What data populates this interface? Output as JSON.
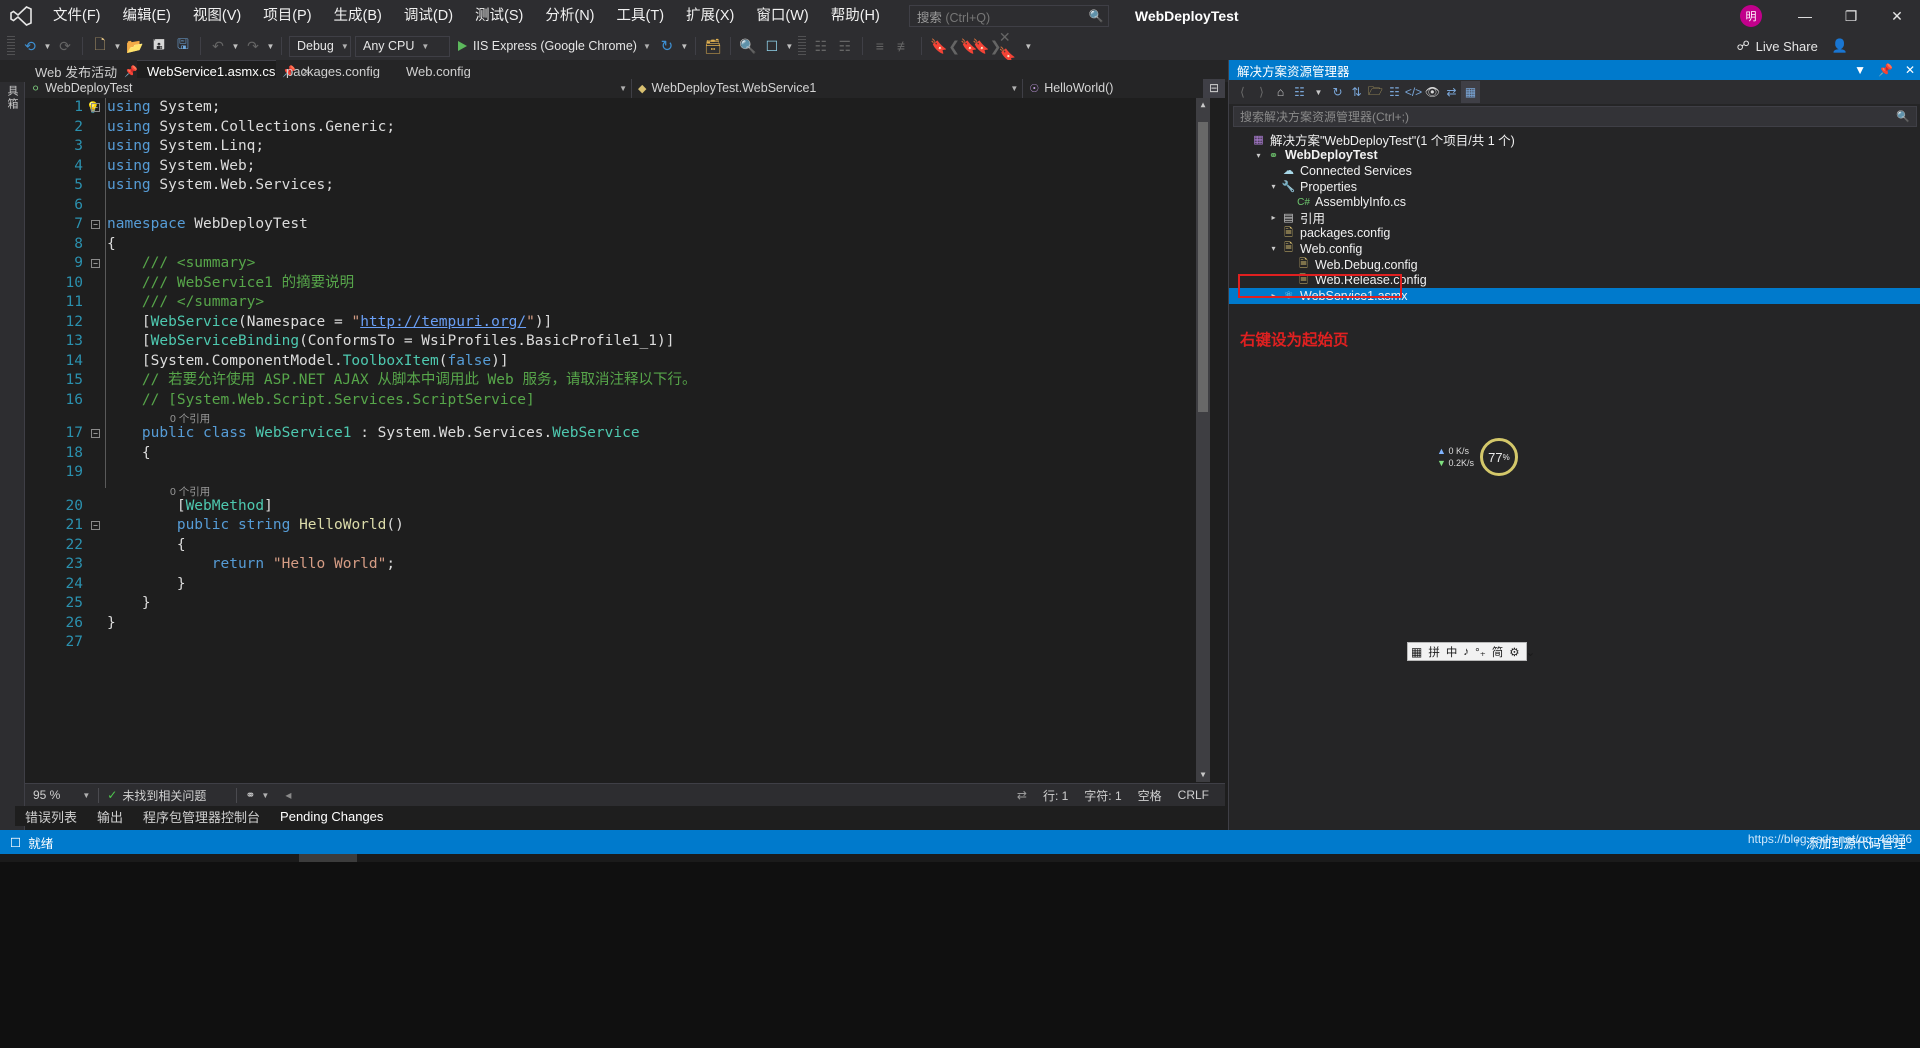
{
  "app": {
    "project_title": "WebDeployTest",
    "logo_icon": "visual-studio-logo-icon"
  },
  "menu": {
    "items": [
      {
        "label": "文件(F)"
      },
      {
        "label": "编辑(E)"
      },
      {
        "label": "视图(V)"
      },
      {
        "label": "项目(P)"
      },
      {
        "label": "生成(B)"
      },
      {
        "label": "调试(D)"
      },
      {
        "label": "测试(S)"
      },
      {
        "label": "分析(N)"
      },
      {
        "label": "工具(T)"
      },
      {
        "label": "扩展(X)"
      },
      {
        "label": "窗口(W)"
      },
      {
        "label": "帮助(H)"
      }
    ]
  },
  "search": {
    "label": "搜索",
    "placeholder": "(Ctrl+Q)",
    "icon": "search-icon"
  },
  "window_controls": {
    "avatar_text": "明",
    "minimize": "—",
    "restore": "❐",
    "close": "✕"
  },
  "toolbar": {
    "navigate_back_icon": "navigate-back-icon",
    "navigate_forward_icon": "navigate-forward-icon",
    "new_item_icon": "new-item-icon",
    "open_file_icon": "open-file-icon",
    "save_icon": "save-icon",
    "save_all_icon": "save-all-icon",
    "undo_icon": "undo-icon",
    "redo_icon": "redo-icon",
    "configuration": "Debug",
    "platform": "Any CPU",
    "run_target": "IIS Express (Google Chrome)",
    "refresh_icon": "refresh-icon",
    "play_icon": "play-icon",
    "live_share_label": "Live Share",
    "live_share_icon": "live-share-icon",
    "share_person_icon": "share-person-icon",
    "extra_icons": [
      "attach-to-process-icon",
      "find-in-files-icon",
      "browser-preview-icon",
      "decrease-indent-icon",
      "comment-icon",
      "uncomment-icon",
      "increase-indent-icon",
      "decrease-line-indent-icon",
      "bookmark-icon",
      "previous-bookmark-icon",
      "next-bookmark-icon",
      "clear-bookmark-icon"
    ]
  },
  "left_rail": {
    "label": "工具箱"
  },
  "tabs": [
    {
      "label": "Web 发布活动",
      "active": false,
      "pinned": true,
      "closable": false
    },
    {
      "label": "WebService1.asmx.cs",
      "active": true,
      "pinned": true,
      "closable": true
    },
    {
      "label": "packages.config",
      "active": false,
      "pinned": false,
      "closable": false
    },
    {
      "label": "Web.config",
      "active": false,
      "pinned": false,
      "closable": false
    }
  ],
  "tabstrip_controls": {
    "dropdown_icon": "chevron-down-icon",
    "settings_icon": "gear-icon"
  },
  "navbar": {
    "project": "WebDeployTest",
    "type": "WebDeployTest.WebService1",
    "member": "HelloWorld()",
    "project_icon": "web-project-icon",
    "type_icon": "class-icon",
    "member_icon": "method-icon",
    "split_icon": "split-editor-icon"
  },
  "code": {
    "lines": [
      {
        "n": 1,
        "ref": null,
        "fold": "minus",
        "bulb": true,
        "tokens": [
          {
            "t": "using",
            "c": "kw"
          },
          {
            "t": " System;",
            "c": "pln"
          }
        ]
      },
      {
        "n": 2,
        "ref": null,
        "fold": null,
        "bulb": false,
        "tokens": [
          {
            "t": "using",
            "c": "kw"
          },
          {
            "t": " System.Collections.Generic;",
            "c": "pln"
          }
        ]
      },
      {
        "n": 3,
        "ref": null,
        "fold": null,
        "bulb": false,
        "tokens": [
          {
            "t": "using",
            "c": "kw"
          },
          {
            "t": " System.Linq;",
            "c": "pln"
          }
        ]
      },
      {
        "n": 4,
        "ref": null,
        "fold": null,
        "bulb": false,
        "tokens": [
          {
            "t": "using",
            "c": "kw"
          },
          {
            "t": " System.Web;",
            "c": "pln"
          }
        ]
      },
      {
        "n": 5,
        "ref": null,
        "fold": null,
        "bulb": false,
        "tokens": [
          {
            "t": "using",
            "c": "kw"
          },
          {
            "t": " System.Web.Services;",
            "c": "pln"
          }
        ]
      },
      {
        "n": 6,
        "ref": null,
        "fold": null,
        "bulb": false,
        "tokens": []
      },
      {
        "n": 7,
        "ref": null,
        "fold": "minus",
        "bulb": false,
        "tokens": [
          {
            "t": "namespace",
            "c": "kw"
          },
          {
            "t": " WebDeployTest",
            "c": "pln"
          }
        ]
      },
      {
        "n": 8,
        "ref": null,
        "fold": null,
        "bulb": false,
        "tokens": [
          {
            "t": "{",
            "c": "pln"
          }
        ]
      },
      {
        "n": 9,
        "ref": null,
        "fold": "minus",
        "bulb": false,
        "tokens": [
          {
            "t": "    /// <summary>",
            "c": "cmt"
          }
        ]
      },
      {
        "n": 10,
        "ref": null,
        "fold": null,
        "bulb": false,
        "tokens": [
          {
            "t": "    /// WebService1 的摘要说明",
            "c": "cmt"
          }
        ]
      },
      {
        "n": 11,
        "ref": null,
        "fold": null,
        "bulb": false,
        "tokens": [
          {
            "t": "    /// </summary>",
            "c": "cmt"
          }
        ]
      },
      {
        "n": 12,
        "ref": null,
        "fold": null,
        "bulb": false,
        "tokens": [
          {
            "t": "    [",
            "c": "pln"
          },
          {
            "t": "WebService",
            "c": "typ"
          },
          {
            "t": "(Namespace = ",
            "c": "pln"
          },
          {
            "t": "\"",
            "c": "str"
          },
          {
            "t": "http://tempuri.org/",
            "c": "lnk"
          },
          {
            "t": "\"",
            "c": "str"
          },
          {
            "t": ")]",
            "c": "pln"
          }
        ]
      },
      {
        "n": 13,
        "ref": null,
        "fold": null,
        "bulb": false,
        "tokens": [
          {
            "t": "    [",
            "c": "pln"
          },
          {
            "t": "WebServiceBinding",
            "c": "typ"
          },
          {
            "t": "(ConformsTo = WsiProfiles.BasicProfile1_1)]",
            "c": "pln"
          }
        ]
      },
      {
        "n": 14,
        "ref": null,
        "fold": null,
        "bulb": false,
        "tokens": [
          {
            "t": "    [System.ComponentModel.",
            "c": "pln"
          },
          {
            "t": "ToolboxItem",
            "c": "typ"
          },
          {
            "t": "(",
            "c": "pln"
          },
          {
            "t": "false",
            "c": "kw"
          },
          {
            "t": ")]",
            "c": "pln"
          }
        ]
      },
      {
        "n": 15,
        "ref": null,
        "fold": null,
        "bulb": false,
        "tokens": [
          {
            "t": "    // 若要允许使用 ASP.NET AJAX 从脚本中调用此 Web 服务，请取消注释以下行。",
            "c": "cmt"
          }
        ]
      },
      {
        "n": 16,
        "ref": null,
        "fold": null,
        "bulb": false,
        "tokens": [
          {
            "t": "    // [System.Web.Script.Services.ScriptService]",
            "c": "cmt"
          }
        ]
      },
      {
        "n": 17,
        "ref": "0 个引用",
        "fold": "minus",
        "bulb": false,
        "tokens": [
          {
            "t": "    public",
            "c": "kw"
          },
          {
            "t": " ",
            "c": "pln"
          },
          {
            "t": "class",
            "c": "kw"
          },
          {
            "t": " ",
            "c": "pln"
          },
          {
            "t": "WebService1",
            "c": "typ"
          },
          {
            "t": " : System.Web.Services.",
            "c": "pln"
          },
          {
            "t": "WebService",
            "c": "typ"
          }
        ]
      },
      {
        "n": 18,
        "ref": null,
        "fold": null,
        "bulb": false,
        "tokens": [
          {
            "t": "    {",
            "c": "pln"
          }
        ]
      },
      {
        "n": 19,
        "ref": null,
        "fold": null,
        "bulb": false,
        "tokens": []
      },
      {
        "n": 20,
        "ref": "0 个引用",
        "fold": null,
        "bulb": false,
        "tokens": [
          {
            "t": "        [",
            "c": "pln"
          },
          {
            "t": "WebMethod",
            "c": "typ"
          },
          {
            "t": "]",
            "c": "pln"
          }
        ]
      },
      {
        "n": 21,
        "ref": null,
        "fold": "minus",
        "bulb": false,
        "tokens": [
          {
            "t": "        public",
            "c": "kw"
          },
          {
            "t": " ",
            "c": "pln"
          },
          {
            "t": "string",
            "c": "kw"
          },
          {
            "t": " ",
            "c": "pln"
          },
          {
            "t": "HelloWorld",
            "c": "fn"
          },
          {
            "t": "()",
            "c": "pln"
          }
        ]
      },
      {
        "n": 22,
        "ref": null,
        "fold": null,
        "bulb": false,
        "tokens": [
          {
            "t": "        {",
            "c": "pln"
          }
        ]
      },
      {
        "n": 23,
        "ref": null,
        "fold": null,
        "bulb": false,
        "tokens": [
          {
            "t": "            return",
            "c": "kw"
          },
          {
            "t": " ",
            "c": "pln"
          },
          {
            "t": "\"Hello World\"",
            "c": "str"
          },
          {
            "t": ";",
            "c": "pln"
          }
        ]
      },
      {
        "n": 24,
        "ref": null,
        "fold": null,
        "bulb": false,
        "tokens": [
          {
            "t": "        }",
            "c": "pln"
          }
        ]
      },
      {
        "n": 25,
        "ref": null,
        "fold": null,
        "bulb": false,
        "tokens": [
          {
            "t": "    }",
            "c": "pln"
          }
        ]
      },
      {
        "n": 26,
        "ref": null,
        "fold": null,
        "bulb": false,
        "tokens": [
          {
            "t": "}",
            "c": "pln"
          }
        ]
      },
      {
        "n": 27,
        "ref": null,
        "fold": null,
        "bulb": false,
        "tokens": []
      }
    ]
  },
  "editor_status": {
    "zoom": "95 %",
    "issues": "未找到相关问题",
    "issue_icon": "check-circle-icon",
    "line_label": "行: 1",
    "col_label": "字符: 1",
    "spaces": "空格",
    "eol": "CRLF",
    "nav_icon": "navigation-icon"
  },
  "bottom_tabs": [
    {
      "label": "错误列表"
    },
    {
      "label": "输出"
    },
    {
      "label": "程序包管理器控制台"
    },
    {
      "label": "Pending Changes",
      "selected": true
    }
  ],
  "status_bar": {
    "ready": "就绪",
    "ready_icon": "ready-icon",
    "right_text": "添加到源代码管理",
    "right_icon": "source-control-icon"
  },
  "solution_explorer": {
    "title": "解决方案资源管理器",
    "title_controls": {
      "dropdown_icon": "chevron-down-icon",
      "pin_icon": "pin-icon",
      "close_icon": "close-icon"
    },
    "toolbar_icons": [
      "back-icon",
      "forward-icon",
      "home-icon",
      "pending-changes-icon",
      "chevron-down-icon",
      "refresh-icon",
      "collapse-all-icon",
      "show-all-files-icon",
      "properties-window-icon",
      "view-code-icon",
      "preview-selected-icon",
      "sync-with-active-icon",
      "solution-explorer-icon"
    ],
    "search_placeholder": "搜索解决方案资源管理器(Ctrl+;)",
    "search_icon": "search-icon",
    "tree": [
      {
        "indent": 0,
        "twisty": "",
        "icon": "solution-icon",
        "label": "解决方案\"WebDeployTest\"(1 个项目/共 1 个)",
        "bold": false,
        "selected": false
      },
      {
        "indent": 1,
        "twisty": "expanded",
        "icon": "web-project-icon",
        "label": "WebDeployTest",
        "bold": true,
        "selected": false
      },
      {
        "indent": 2,
        "twisty": "",
        "icon": "connected-services-icon",
        "label": "Connected Services",
        "bold": false,
        "selected": false
      },
      {
        "indent": 2,
        "twisty": "expanded",
        "icon": "properties-icon",
        "label": "Properties",
        "bold": false,
        "selected": false
      },
      {
        "indent": 3,
        "twisty": "",
        "icon": "csharp-file-icon",
        "label": "AssemblyInfo.cs",
        "bold": false,
        "selected": false
      },
      {
        "indent": 2,
        "twisty": "collapsed",
        "icon": "references-icon",
        "label": "引用",
        "bold": false,
        "selected": false
      },
      {
        "indent": 2,
        "twisty": "",
        "icon": "config-file-icon",
        "label": "packages.config",
        "bold": false,
        "selected": false
      },
      {
        "indent": 2,
        "twisty": "expanded",
        "icon": "config-file-icon",
        "label": "Web.config",
        "bold": false,
        "selected": false
      },
      {
        "indent": 3,
        "twisty": "",
        "icon": "config-file-icon",
        "label": "Web.Debug.config",
        "bold": false,
        "selected": false
      },
      {
        "indent": 3,
        "twisty": "",
        "icon": "config-file-icon",
        "label": "Web.Release.config",
        "bold": false,
        "selected": false
      },
      {
        "indent": 2,
        "twisty": "collapsed",
        "icon": "asmx-file-icon",
        "label": "WebService1.asmx",
        "bold": false,
        "selected": true
      }
    ],
    "annotation": "右键设为起始页"
  },
  "network_widget": {
    "upload": "0 K/s",
    "download": "0.2K/s",
    "cpu_value": "77",
    "cpu_unit": "%",
    "up_icon": "arrow-up-icon",
    "down_icon": "arrow-down-icon"
  },
  "ime_bar": {
    "items": [
      "拼",
      "中",
      "♪",
      "°₊",
      "简",
      "⚙",
      "⌄"
    ],
    "layout_icon": "ime-layout-icon"
  },
  "watermark": "https://blog.csdn.net/qq_43876"
}
